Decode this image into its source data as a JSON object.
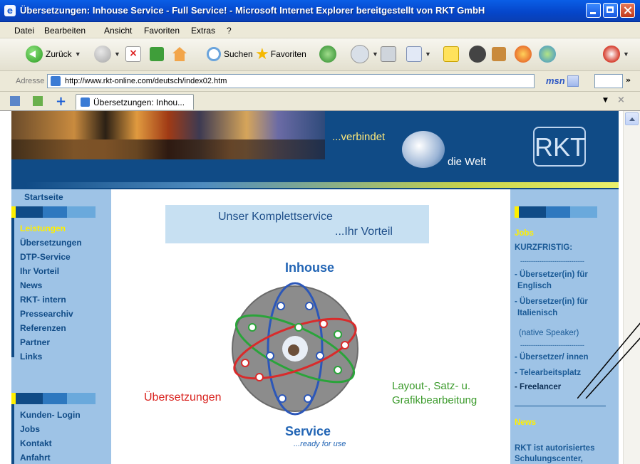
{
  "window": {
    "title": "Übersetzungen: Inhouse Service - Full Service! - Microsoft Internet Explorer bereitgestellt von RKT GmbH"
  },
  "menu": [
    "Datei",
    "Bearbeiten",
    "Ansicht",
    "Favoriten",
    "Extras",
    "?"
  ],
  "toolbar": {
    "back_label": "Zurück",
    "search_label": "Suchen",
    "favorites_label": "Favoriten"
  },
  "address": {
    "label": "Adresse",
    "url": "http://www.rkt-online.com/deutsch/index02.htm",
    "msn": "msn"
  },
  "tab": {
    "label": "Übersetzungen: Inhou..."
  },
  "banner": {
    "slogan1": "...verbindet",
    "slogan2": "die Welt",
    "logo": "RKT"
  },
  "left_nav": {
    "start": "Startseite",
    "items": [
      "Leistungen",
      "Übersetzungen",
      "DTP-Service",
      "Ihr Vorteil",
      "News",
      "RKT- intern",
      "Pressearchiv",
      "Referenzen",
      "Partner",
      "Links"
    ],
    "items2": [
      "Kunden- Login",
      "Jobs",
      "Kontakt",
      "Anfahrt"
    ]
  },
  "main": {
    "heading1": "Unser Komplettservice",
    "heading2": "...Ihr Vorteil",
    "inhouse": "Inhouse",
    "service": "Service",
    "ready": "...ready for use",
    "uebersetzungen": "Übersetzungen",
    "layout1": "Layout-, Satz- u.",
    "layout2": "Grafikbearbeitung"
  },
  "right_nav": {
    "jobs": "Jobs",
    "kurzfristig": "KURZFRISTIG:",
    "dashes": "------------------------------",
    "job1a": "- Übersetzer(in) für",
    "job1b": "Englisch",
    "job2a": "- Übersetzer(in) für",
    "job2b": "Italienisch",
    "native": "(native Speaker)",
    "job3": "- Übersetzer/ innen",
    "job4": "- Telearbeitsplatz",
    "job5": "- Freelancer",
    "news": "News",
    "news1": "RKT ist autorisiertes",
    "news2": "Schulungscenter,"
  },
  "colors": {
    "navy": "#104b86",
    "light_blue": "#9ec3e6",
    "yellow": "#ffef00"
  }
}
